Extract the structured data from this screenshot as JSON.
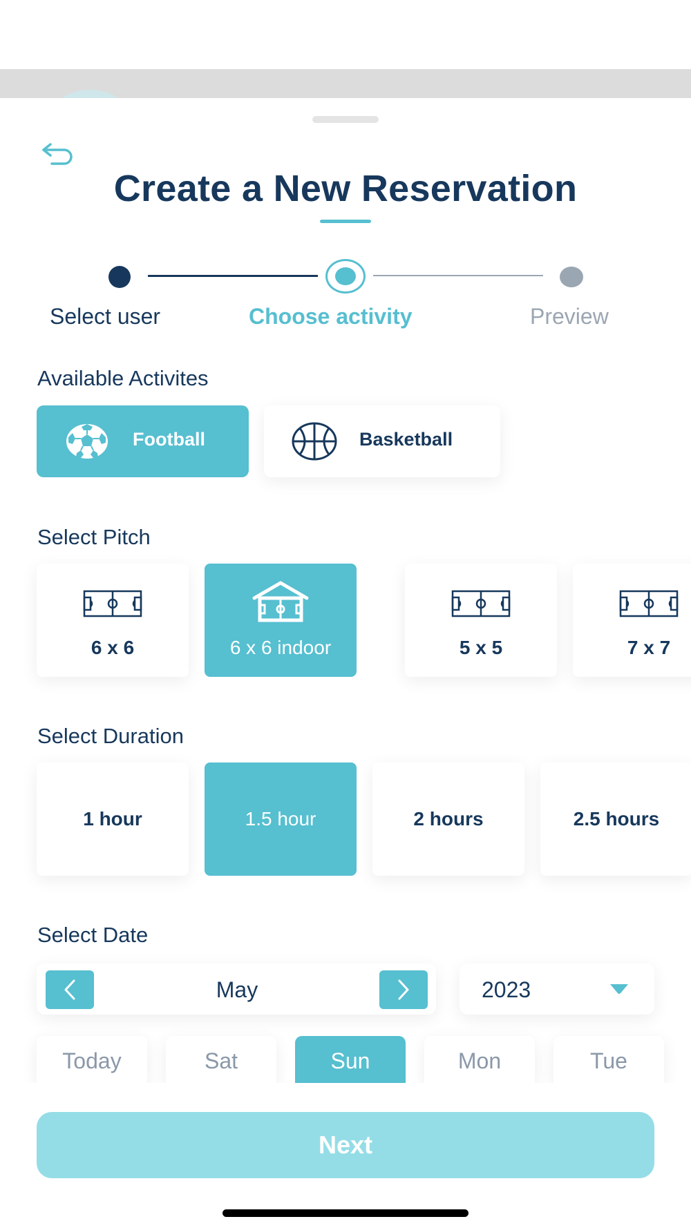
{
  "header": {
    "title": "Create a New Reservation"
  },
  "stepper": {
    "steps": [
      {
        "label": "Select user",
        "state": "done"
      },
      {
        "label": "Choose activity",
        "state": "current"
      },
      {
        "label": "Preview",
        "state": "upcoming"
      }
    ]
  },
  "activities": {
    "title": "Available Activites",
    "items": [
      {
        "label": "Football",
        "icon": "soccer-ball-icon",
        "selected": true
      },
      {
        "label": "Basketball",
        "icon": "basketball-icon",
        "selected": false
      }
    ]
  },
  "pitch": {
    "title": "Select Pitch",
    "items": [
      {
        "label": "6 x 6",
        "icon": "pitch-icon",
        "selected": false
      },
      {
        "label": "6 x 6 indoor",
        "icon": "indoor-pitch-icon",
        "selected": true
      },
      {
        "label": "5 x 5",
        "icon": "pitch-icon",
        "selected": false
      },
      {
        "label": "7 x 7",
        "icon": "pitch-icon",
        "selected": false
      }
    ]
  },
  "duration": {
    "title": "Select Duration",
    "items": [
      {
        "label": "1 hour",
        "selected": false
      },
      {
        "label": "1.5 hour",
        "selected": true
      },
      {
        "label": "2 hours",
        "selected": false
      },
      {
        "label": "2.5 hours",
        "selected": false
      }
    ]
  },
  "date": {
    "title": "Select Date",
    "month": "May",
    "year": "2023",
    "days": [
      {
        "label": "Today",
        "selected": false
      },
      {
        "label": "Sat",
        "selected": false
      },
      {
        "label": "Sun",
        "selected": true
      },
      {
        "label": "Mon",
        "selected": false
      },
      {
        "label": "Tue",
        "selected": false
      }
    ]
  },
  "footer": {
    "next_label": "Next"
  },
  "colors": {
    "primary": "#56bfd0",
    "navy": "#17385c",
    "muted": "#9aa6b2",
    "next_disabled": "#95dde6"
  }
}
